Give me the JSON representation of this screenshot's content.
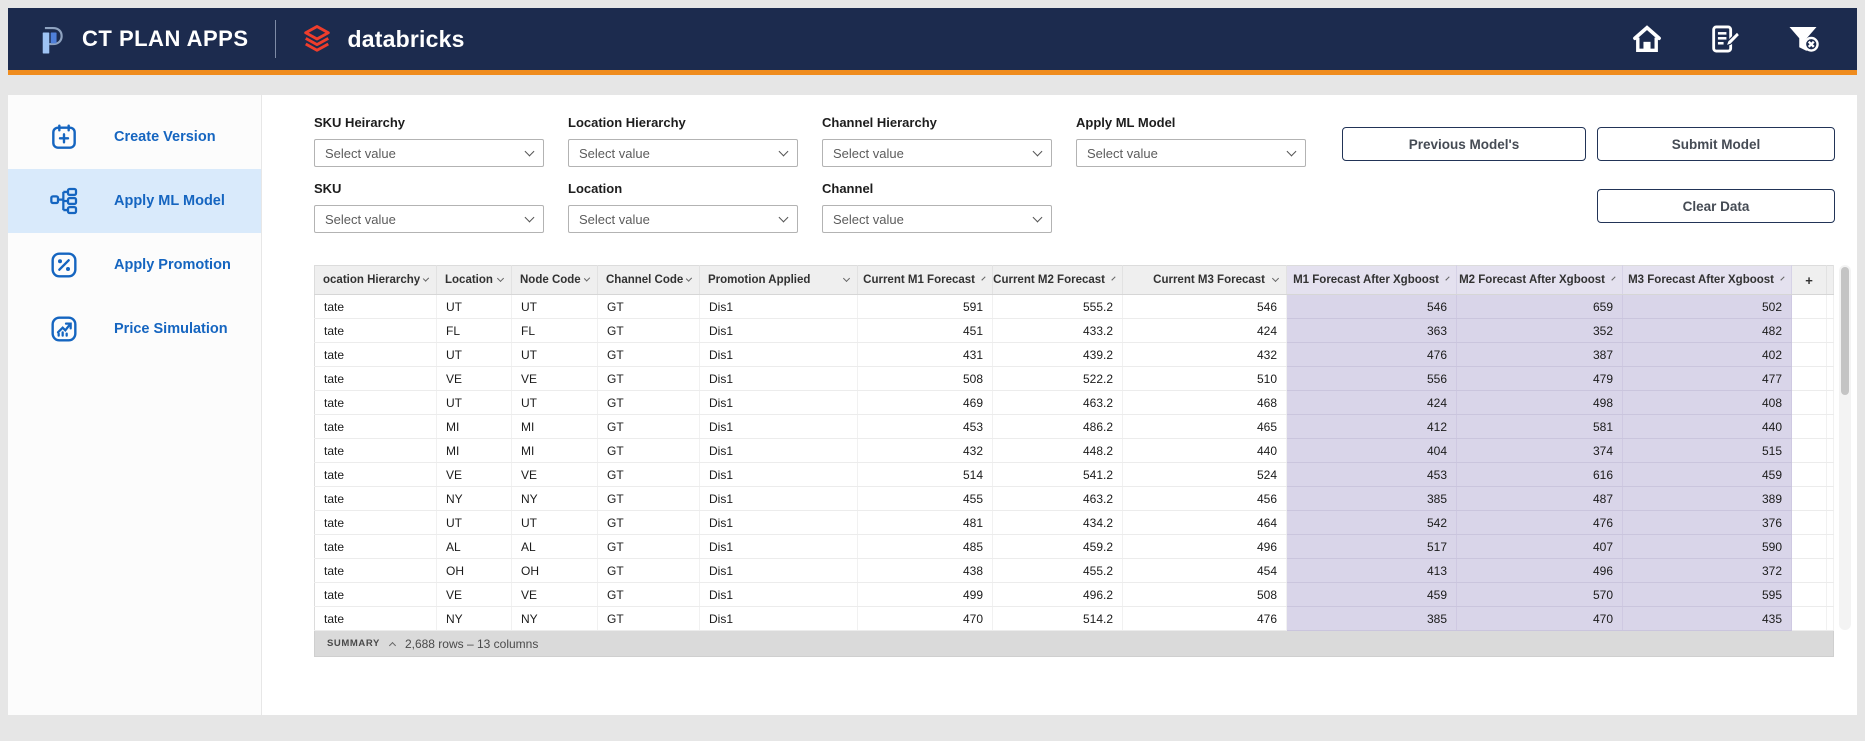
{
  "colors": {
    "navbar_bg": "#1c2b4e",
    "accent_orange": "#ef8c1e",
    "sidebar_blue": "#1565c0",
    "active_item_bg": "#d9eafb",
    "xgboost_column_bg": "#d9d5e9",
    "databricks_red": "#ee3d2c"
  },
  "navbar": {
    "app_title": "CT PLAN APPS",
    "brand": "databricks",
    "icons": [
      "ct-plan-logo-icon",
      "databricks-logo-icon",
      "home-icon",
      "notes-edit-icon",
      "clear-filter-icon"
    ]
  },
  "sidebar": {
    "items": [
      {
        "label": "Create Version",
        "icon": "calendar-plus-icon",
        "active": false
      },
      {
        "label": "Apply ML Model",
        "icon": "hierarchy-icon",
        "active": true
      },
      {
        "label": "Apply Promotion",
        "icon": "percent-icon",
        "active": false
      },
      {
        "label": "Price Simulation",
        "icon": "chart-up-icon",
        "active": false
      }
    ]
  },
  "filters": {
    "row1": [
      {
        "label": "SKU Heirarchy",
        "value": "Select value"
      },
      {
        "label": "Location Hierarchy",
        "value": "Select value"
      },
      {
        "label": "Channel Hierarchy",
        "value": "Select value"
      },
      {
        "label": "Apply ML Model",
        "value": "Select value"
      }
    ],
    "row2": [
      {
        "label": "SKU",
        "value": "Select value"
      },
      {
        "label": "Location",
        "value": "Select value"
      },
      {
        "label": "Channel",
        "value": "Select value"
      }
    ],
    "dropdown_icon": "chevron-down-icon"
  },
  "buttons": {
    "previous": "Previous Model's",
    "submit": "Submit Model",
    "clear": "Clear Data"
  },
  "table": {
    "columns": [
      "ocation Hierarchy",
      "Location",
      "Node Code",
      "Channel Code",
      "Promotion Applied",
      "Current M1 Forecast",
      "Current M2 Forecast",
      "Current M3 Forecast",
      "M1 Forecast After Xgboost",
      "M2 Forecast After Xgboost",
      "M3 Forecast After Xgboost",
      "+"
    ],
    "rows": [
      [
        "tate",
        "UT",
        "UT",
        "GT",
        "Dis1",
        591,
        555.2,
        546,
        546,
        659,
        502
      ],
      [
        "tate",
        "FL",
        "FL",
        "GT",
        "Dis1",
        451,
        433.2,
        424,
        363,
        352,
        482
      ],
      [
        "tate",
        "UT",
        "UT",
        "GT",
        "Dis1",
        431,
        439.2,
        432,
        476,
        387,
        402
      ],
      [
        "tate",
        "VE",
        "VE",
        "GT",
        "Dis1",
        508,
        522.2,
        510,
        556,
        479,
        477
      ],
      [
        "tate",
        "UT",
        "UT",
        "GT",
        "Dis1",
        469,
        463.2,
        468,
        424,
        498,
        408
      ],
      [
        "tate",
        "MI",
        "MI",
        "GT",
        "Dis1",
        453,
        486.2,
        465,
        412,
        581,
        440
      ],
      [
        "tate",
        "MI",
        "MI",
        "GT",
        "Dis1",
        432,
        448.2,
        440,
        404,
        374,
        515
      ],
      [
        "tate",
        "VE",
        "VE",
        "GT",
        "Dis1",
        514,
        541.2,
        524,
        453,
        616,
        459
      ],
      [
        "tate",
        "NY",
        "NY",
        "GT",
        "Dis1",
        455,
        463.2,
        456,
        385,
        487,
        389
      ],
      [
        "tate",
        "UT",
        "UT",
        "GT",
        "Dis1",
        481,
        434.2,
        464,
        542,
        476,
        376
      ],
      [
        "tate",
        "AL",
        "AL",
        "GT",
        "Dis1",
        485,
        459.2,
        496,
        517,
        407,
        590
      ],
      [
        "tate",
        "OH",
        "OH",
        "GT",
        "Dis1",
        438,
        455.2,
        454,
        413,
        496,
        372
      ],
      [
        "tate",
        "VE",
        "VE",
        "GT",
        "Dis1",
        499,
        496.2,
        508,
        459,
        570,
        595
      ],
      [
        "tate",
        "NY",
        "NY",
        "GT",
        "Dis1",
        470,
        514.2,
        476,
        385,
        470,
        435
      ]
    ],
    "summary": {
      "label": "SUMMARY",
      "collapse_icon": "chevron-up-icon",
      "text": "2,688 rows – 13 columns"
    }
  }
}
